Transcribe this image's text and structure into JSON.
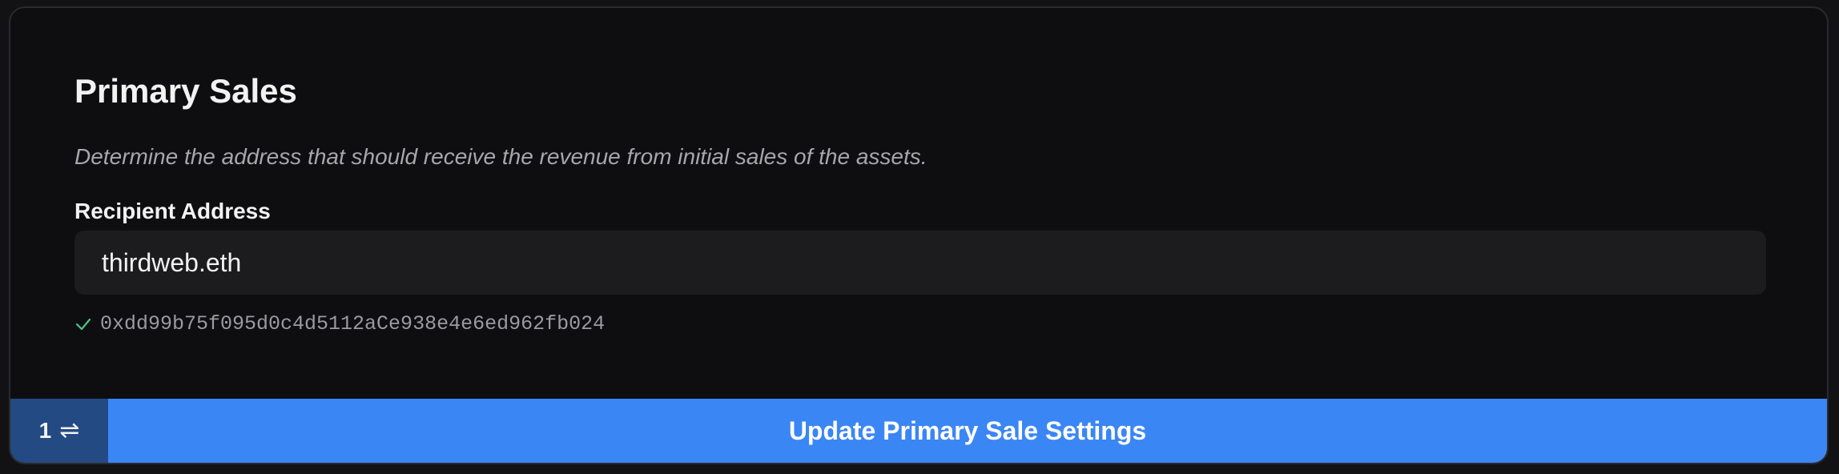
{
  "section": {
    "title": "Primary Sales",
    "description": "Determine the address that should receive the revenue from initial sales of the assets."
  },
  "recipient": {
    "label": "Recipient Address",
    "value": "thirdweb.eth",
    "resolved_address": "0xdd99b75f095d0c4d5112aCe938e4e6ed962fb024",
    "resolved_icon": "check-icon"
  },
  "footer": {
    "tx_count": "1",
    "tx_icon": "swap-arrows-icon",
    "submit_label": "Update Primary Sale Settings"
  },
  "colors": {
    "accent": "#3b86f5",
    "tx_badge": "#244a83",
    "success": "#4cc38a",
    "background": "#0e0e11",
    "input_background": "#1c1c1f"
  }
}
